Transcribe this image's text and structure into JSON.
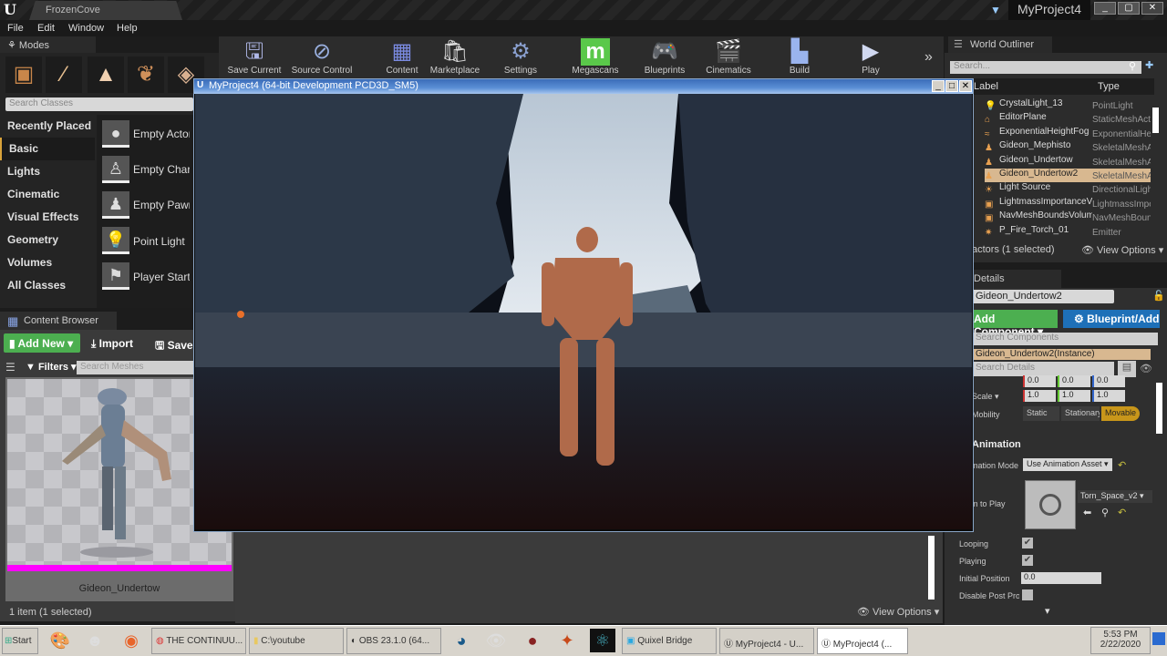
{
  "titlebar": {
    "level_tab": "FrozenCove",
    "project_name": "MyProject4",
    "window_buttons": [
      "_",
      "▢",
      "✕"
    ]
  },
  "menu": [
    "File",
    "Edit",
    "Window",
    "Help"
  ],
  "modes": {
    "tab_label": "Modes",
    "search_placeholder": "Search Classes",
    "categories": [
      {
        "label": "Recently Placed",
        "active": false
      },
      {
        "label": "Basic",
        "active": true
      },
      {
        "label": "Lights",
        "active": false
      },
      {
        "label": "Cinematic",
        "active": false
      },
      {
        "label": "Visual Effects",
        "active": false
      },
      {
        "label": "Geometry",
        "active": false
      },
      {
        "label": "Volumes",
        "active": false
      },
      {
        "label": "All Classes",
        "active": false
      }
    ],
    "classes": [
      {
        "name": "Empty Actor",
        "icon": "sphere-icon"
      },
      {
        "name": "Empty Character",
        "icon": "character-icon"
      },
      {
        "name": "Empty Pawn",
        "icon": "pawn-icon"
      },
      {
        "name": "Point Light",
        "icon": "bulb-icon"
      },
      {
        "name": "Player Start",
        "icon": "flag-icon"
      }
    ]
  },
  "toolbar": {
    "buttons": [
      {
        "label": "Save Current",
        "icon": "save-icon"
      },
      {
        "label": "Source Control",
        "icon": "source-control-icon"
      },
      {
        "label": "Content",
        "icon": "content-icon"
      },
      {
        "label": "Marketplace",
        "icon": "marketplace-icon"
      },
      {
        "label": "Settings",
        "icon": "settings-icon"
      },
      {
        "label": "Megascans",
        "icon": "megascans-icon"
      },
      {
        "label": "Blueprints",
        "icon": "blueprints-icon"
      },
      {
        "label": "Cinematics",
        "icon": "cinematics-icon"
      },
      {
        "label": "Build",
        "icon": "build-icon"
      },
      {
        "label": "Play",
        "icon": "play-icon"
      }
    ],
    "more": "»"
  },
  "content_browser": {
    "tab_label": "Content Browser",
    "add_new": "Add New ▾",
    "import": "Import",
    "save": "Save",
    "filters": "Filters ▾",
    "search_placeholder": "Search Meshes",
    "asset_name": "Gideon_Undertow",
    "accent": "#ff00ff",
    "status": "1 item (1 selected)"
  },
  "game_window": {
    "title": "MyProject4 (64-bit Development PCD3D_SM5)"
  },
  "world_outliner": {
    "tab_label": "World Outliner",
    "search_placeholder": "Search...",
    "col_label": "Label",
    "col_type": "Type",
    "rows": [
      {
        "name": "CrystalLight_13",
        "type": "PointLight",
        "selected": false
      },
      {
        "name": "EditorPlane",
        "type": "StaticMeshActor",
        "selected": false
      },
      {
        "name": "ExponentialHeightFog",
        "type": "ExponentialHeightFog",
        "selected": false
      },
      {
        "name": "Gideon_Mephisto",
        "type": "SkeletalMeshActor",
        "selected": false
      },
      {
        "name": "Gideon_Undertow",
        "type": "SkeletalMeshActor",
        "selected": false
      },
      {
        "name": "Gideon_Undertow2",
        "type": "SkeletalMeshActor",
        "selected": true
      },
      {
        "name": "Light Source",
        "type": "DirectionalLight",
        "selected": false
      },
      {
        "name": "LightmassImportanceVolume",
        "type": "LightmassImportanceVolume",
        "selected": false
      },
      {
        "name": "NavMeshBoundsVolume",
        "type": "NavMeshBoundsVolume",
        "selected": false
      },
      {
        "name": "P_Fire_Torch_01",
        "type": "Emitter",
        "selected": false
      }
    ],
    "status": "actors (1 selected)",
    "view_options": "View Options ▾"
  },
  "details": {
    "tab_label": "Details",
    "actor_name": "Gideon_Undertow2",
    "add_component": "Add Component ▾",
    "blueprint": "Blueprint/Add Script",
    "search_components_placeholder": "Search Components",
    "instance": "Gideon_Undertow2(Instance)",
    "search_details_placeholder": "Search Details",
    "location_values": [
      "0.0",
      "0.0",
      "0.0"
    ],
    "scale_label": "Scale ▾",
    "scale_values": [
      "1.0",
      "1.0",
      "1.0"
    ],
    "mobility_label": "Mobility",
    "mobility_options": [
      "Static",
      "Stationary",
      "Movable"
    ],
    "mobility_selected": "Movable",
    "animation_header": "Animation",
    "animation_mode_label": "Animation Mode",
    "animation_mode": "Use Animation Asset",
    "anim_to_play_label": "Anim to Play",
    "anim_asset": "Torn_Space_v2",
    "looping_label": "Looping",
    "looping": true,
    "playing_label": "Playing",
    "playing": true,
    "initial_position_label": "Initial Position",
    "initial_position": "0.0",
    "disable_post_label": "Disable Post Process",
    "disable_post": false
  },
  "bottom": {
    "view_options": "View Options ▾"
  },
  "taskbar": {
    "start": "Start",
    "tasks": [
      {
        "label": "THE CONTINUU...",
        "icon": "chrome-icon",
        "active": false
      },
      {
        "label": "C:\\youtube",
        "icon": "folder-icon",
        "active": false
      },
      {
        "label": "OBS 23.1.0 (64...",
        "icon": "obs-icon",
        "active": false
      },
      {
        "label": "Quixel Bridge",
        "icon": "bridge-icon",
        "active": false
      },
      {
        "label": "MyProject4 - U...",
        "icon": "unreal-icon",
        "active": false
      },
      {
        "label": "MyProject4 (...",
        "icon": "unreal-icon",
        "active": true
      }
    ],
    "time": "5:53 PM",
    "date": "2/22/2020"
  }
}
